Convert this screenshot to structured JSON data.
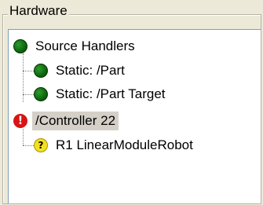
{
  "group": {
    "title": "Hardware"
  },
  "tree": {
    "nodes": [
      {
        "label": "Source Handlers",
        "icon": "green-status-icon",
        "status_color": "#0f6b0f"
      },
      {
        "label": "Static: /Part",
        "icon": "green-status-icon",
        "status_color": "#0f6b0f"
      },
      {
        "label": "Static: /Part Target",
        "icon": "green-status-icon",
        "status_color": "#0f6b0f"
      },
      {
        "label": "/Controller 22",
        "icon": "error-icon",
        "icon_glyph": "!",
        "status_color": "#d81414",
        "selected": true
      },
      {
        "label": "R1 LinearModuleRobot",
        "icon": "question-icon",
        "icon_glyph": "?",
        "status_color": "#f4e020"
      }
    ]
  }
}
